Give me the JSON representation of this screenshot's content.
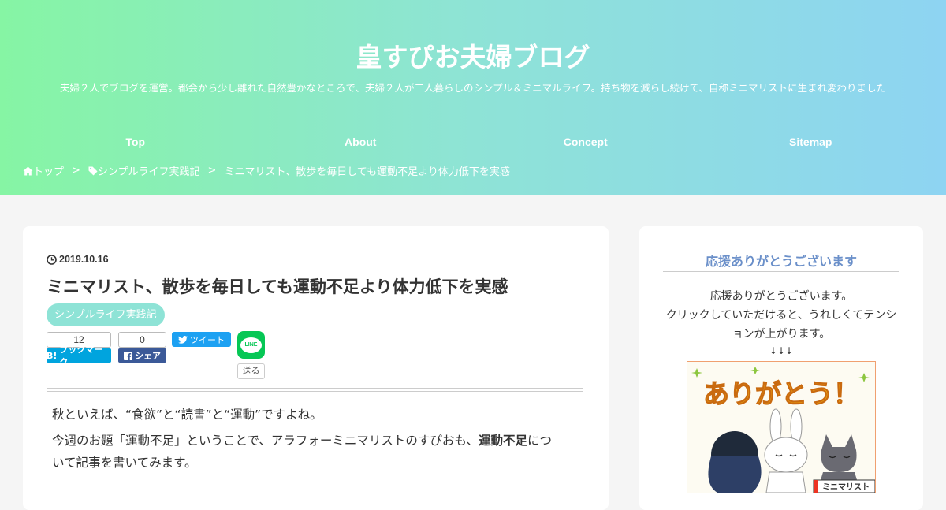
{
  "site": {
    "title": "皇すぴお夫婦ブログ",
    "tagline": "夫婦２人でブログを運営。都会から少し離れた自然豊かなところで、夫婦２人が二人暮らしのシンプル＆ミニマルライフ。持ち物を減らし続けて、自称ミニマリストに生まれ変わりました"
  },
  "nav": {
    "items": [
      "Top",
      "About",
      "Concept",
      "Sitemap"
    ]
  },
  "breadcrumb": {
    "home": "トップ",
    "separator": ">",
    "category": "シンプルライフ実践記",
    "current": "ミニマリスト、散歩を毎日しても運動不足より体力低下を実感"
  },
  "article": {
    "date": "2019.10.16",
    "title": "ミニマリスト、散歩を毎日しても運動不足より体力低下を実感",
    "category": "シンプルライフ実践記",
    "share": {
      "hatena_count": "12",
      "hatena_label": "ブックマーク",
      "facebook_count": "0",
      "facebook_label": "シェア",
      "tweet_label": "ツイート",
      "line_label": "LINE",
      "line_send": "送る"
    },
    "para1": "秋といえば、“食欲”と“読書”と“運動”ですよね。",
    "para2_pre": "今週のお題「運動不足」ということで、アラフォーミニマリストのすぴおも、",
    "para2_bold": "運動不足",
    "para2_mid": "につ",
    "para2_post": "いて記事を書いてみます。"
  },
  "sidebar": {
    "title": "応援ありがとうございます",
    "line1": "応援ありがとうございます。",
    "line2": "クリックしていただけると、うれしくてテンシ",
    "line3": "ョンが上がります。",
    "arrows": "↓↓↓",
    "image_text": "ありがとう！",
    "image_badge": "ミニマリスト"
  },
  "colors": {
    "header_gradient": [
      "#86f5a4",
      "#8ed4f2"
    ],
    "category_badge": "#8ee3d6",
    "sidebar_title": "#6a8fc9",
    "hatena": "#00a4de",
    "facebook": "#3b5998",
    "twitter": "#1da1f2",
    "line": "#06c755"
  }
}
